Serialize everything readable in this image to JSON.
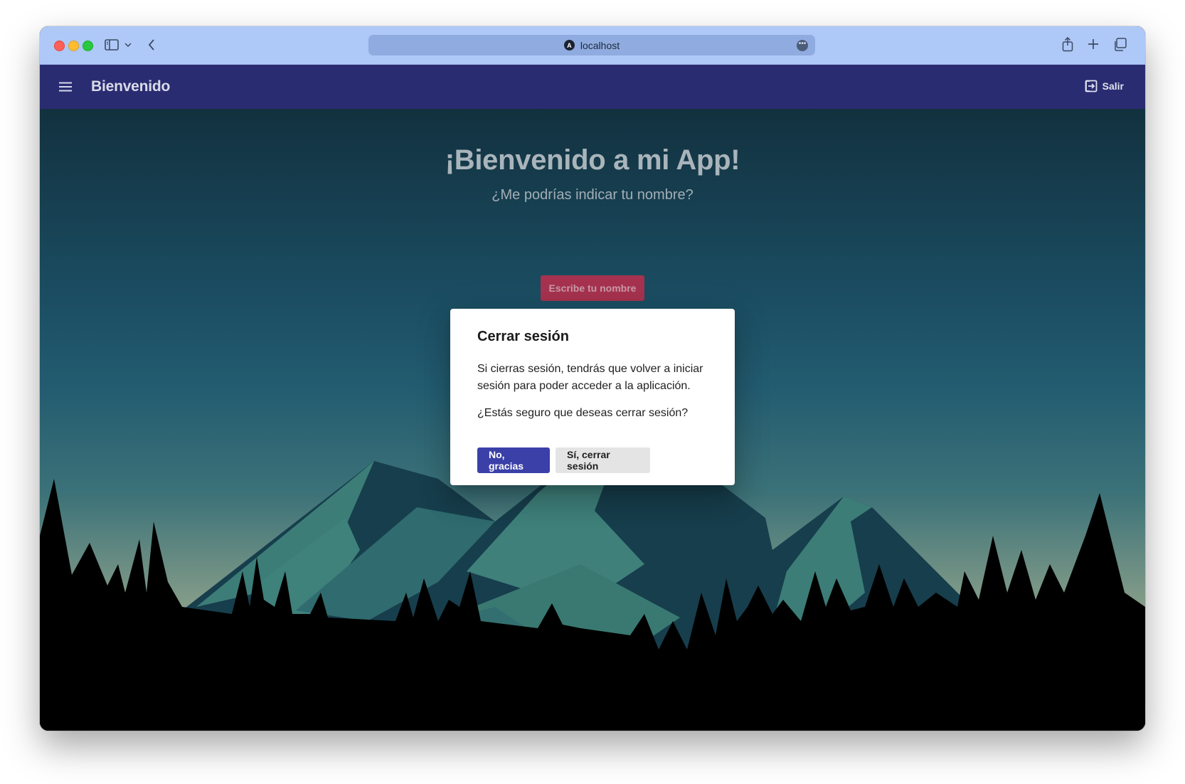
{
  "browser": {
    "url": "localhost",
    "site_icon_letter": "A",
    "icons": [
      "sidebar-icon",
      "chevron-down-icon",
      "back-icon",
      "share-icon",
      "new-tab-icon",
      "tabs-overview-icon",
      "more-icon"
    ]
  },
  "toolbar": {
    "title": "Bienvenido",
    "logout_label": "Salir",
    "colors": {
      "background": "#2a2c72",
      "text": "#d9dbe8"
    }
  },
  "hero": {
    "title": "¡Bienvenido a mi App!",
    "subtitle": "¿Me podrías indicar tu nombre?",
    "name_button_label": "Escribe tu nombre",
    "name_button_color": "#a6324f"
  },
  "dialog": {
    "title": "Cerrar sesión",
    "message": "Si cierras sesión, tendrás que volver a iniciar sesión para poder acceder a la aplicación.",
    "question": "¿Estás seguro que deseas cerrar sesión?",
    "cancel_label": "No, gracias",
    "confirm_label": "Sí, cerrar sesión",
    "colors": {
      "primary": "#3a40a8",
      "secondary": "#e4e4e4"
    }
  }
}
